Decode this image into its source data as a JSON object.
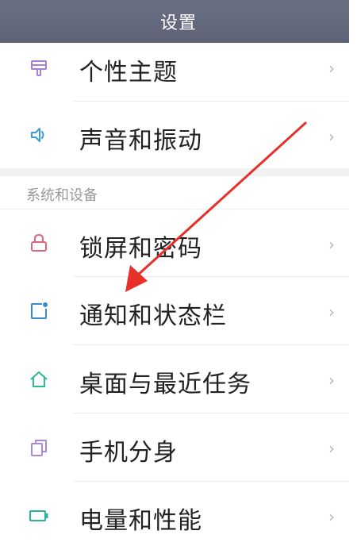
{
  "header": {
    "title": "设置"
  },
  "section_top": {
    "items": [
      {
        "label": "个性主题",
        "icon": "theme-brush-icon"
      },
      {
        "label": "声音和振动",
        "icon": "speaker-icon"
      }
    ]
  },
  "section_system": {
    "header": "系统和设备",
    "items": [
      {
        "label": "锁屏和密码",
        "icon": "lock-icon"
      },
      {
        "label": "通知和状态栏",
        "icon": "notification-icon"
      },
      {
        "label": "桌面与最近任务",
        "icon": "home-icon"
      },
      {
        "label": "手机分身",
        "icon": "dual-space-icon"
      },
      {
        "label": "电量和性能",
        "icon": "battery-icon"
      }
    ]
  },
  "chevron": "›",
  "colors": {
    "titlebar": "#62667a",
    "theme_icon": "#a77fd4",
    "sound_icon": "#3a9bd8",
    "lock_icon": "#e0647a",
    "notification_icon": "#3a8cc8",
    "home_icon": "#2fb79a",
    "dual_icon": "#a98ad6",
    "battery_icon": "#27b39e",
    "annotation_arrow": "#e8302a"
  }
}
